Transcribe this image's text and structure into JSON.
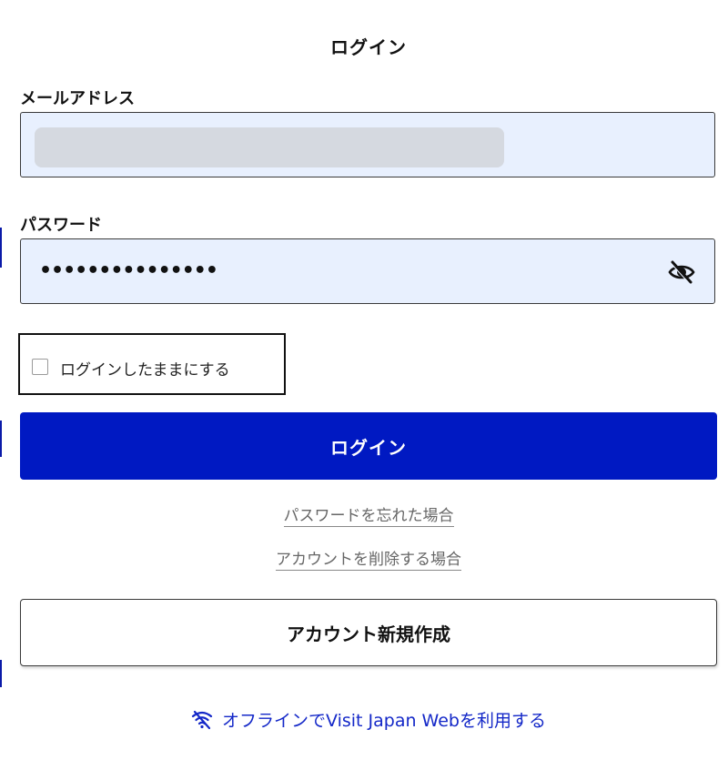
{
  "title": "ログイン",
  "email": {
    "label": "メールアドレス",
    "value": ""
  },
  "password": {
    "label": "パスワード",
    "masked_value": "•••••••••••••••",
    "toggle_icon": "eye-slash-icon"
  },
  "remember": {
    "label": "ログインしたままにする",
    "checked": false
  },
  "login_button": {
    "label": "ログイン"
  },
  "links": {
    "forgot_password": "パスワードを忘れた場合",
    "delete_account": "アカウントを削除する場合"
  },
  "create_account_button": {
    "label": "アカウント新規作成"
  },
  "offline": {
    "label": "オフラインでVisit Japan Webを利用する",
    "icon": "wifi-off-icon"
  },
  "colors": {
    "primary": "#0019c2",
    "field_bg": "#e8f0fe",
    "link_blue": "#1428c8"
  }
}
